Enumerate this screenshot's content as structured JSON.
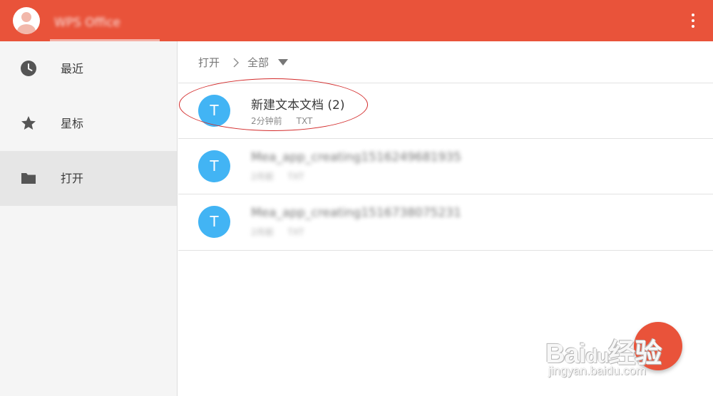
{
  "header": {
    "app_title": "WPS Office",
    "avatar_icon": "user-avatar-icon",
    "menu_icon": "more-vert-icon",
    "color": "#e9533a"
  },
  "sidebar": {
    "items": [
      {
        "label": "最近",
        "icon": "clock-icon",
        "active": false
      },
      {
        "label": "星标",
        "icon": "star-icon",
        "active": false
      },
      {
        "label": "打开",
        "icon": "folder-icon",
        "active": true
      }
    ]
  },
  "breadcrumb": {
    "root": "打开",
    "current": "全部"
  },
  "files": [
    {
      "name": "新建文本文档 (2)",
      "time": "2分钟前",
      "type": "TXT",
      "icon_letter": "T",
      "blurred": false
    },
    {
      "name": "Mea_app_creating1516249681935",
      "time": "2月前",
      "type": "TXT",
      "icon_letter": "T",
      "blurred": true
    },
    {
      "name": "Mea_app_creating1516738075231",
      "time": "2月前",
      "type": "TXT",
      "icon_letter": "T",
      "blurred": true
    }
  ],
  "fab": {
    "icon": "add-icon"
  },
  "watermark": {
    "brand": "Bai",
    "brand2": "du",
    "brand3": "经验",
    "url": "jingyan.baidu.com"
  }
}
